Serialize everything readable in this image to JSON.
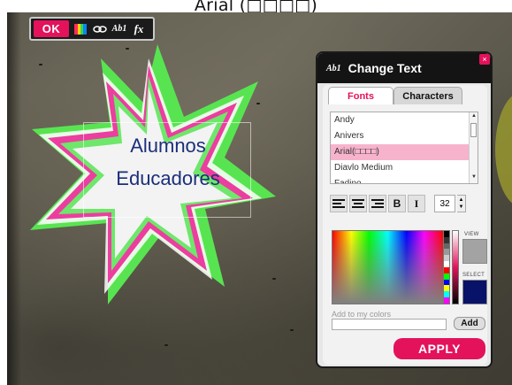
{
  "window_title": "Arial (□□□□)",
  "toolbar": {
    "ok_label": "OK",
    "icons": [
      "color-palette-icon",
      "link-icon",
      "text-edit-icon",
      "effects-icon"
    ],
    "text_icon_label": "Ab1",
    "fx_label": "fx"
  },
  "canvas": {
    "line1": "Alumnos",
    "line2": "Educadores"
  },
  "panel": {
    "title_icon": "Ab1",
    "title": "Change Text",
    "close_label": "×",
    "tabs": [
      {
        "label": "Fonts",
        "active": true
      },
      {
        "label": "Characters",
        "active": false
      }
    ],
    "fonts": [
      "Andy",
      "Anivers",
      "Arial(□□□□)",
      "Diavlo Medium",
      "Fadino"
    ],
    "selected_font": "Arial(□□□□)",
    "format_buttons": {
      "align_left": "align-left-icon",
      "align_center": "align-center-icon",
      "align_right": "align-right-icon",
      "bold": "B",
      "italic": "I"
    },
    "font_size": "32",
    "view_label": "VIEW",
    "select_label": "SELECT",
    "view_color": "#a3a3a3",
    "select_color": "#081268",
    "add_label": "Add to my colors",
    "add_button": "Add",
    "apply_button": "APPLY"
  },
  "colors": {
    "accent": "#e3125b",
    "text_color": "#1b2f7a",
    "star_green": "#56e84f",
    "star_pink": "#ea3f9e"
  }
}
